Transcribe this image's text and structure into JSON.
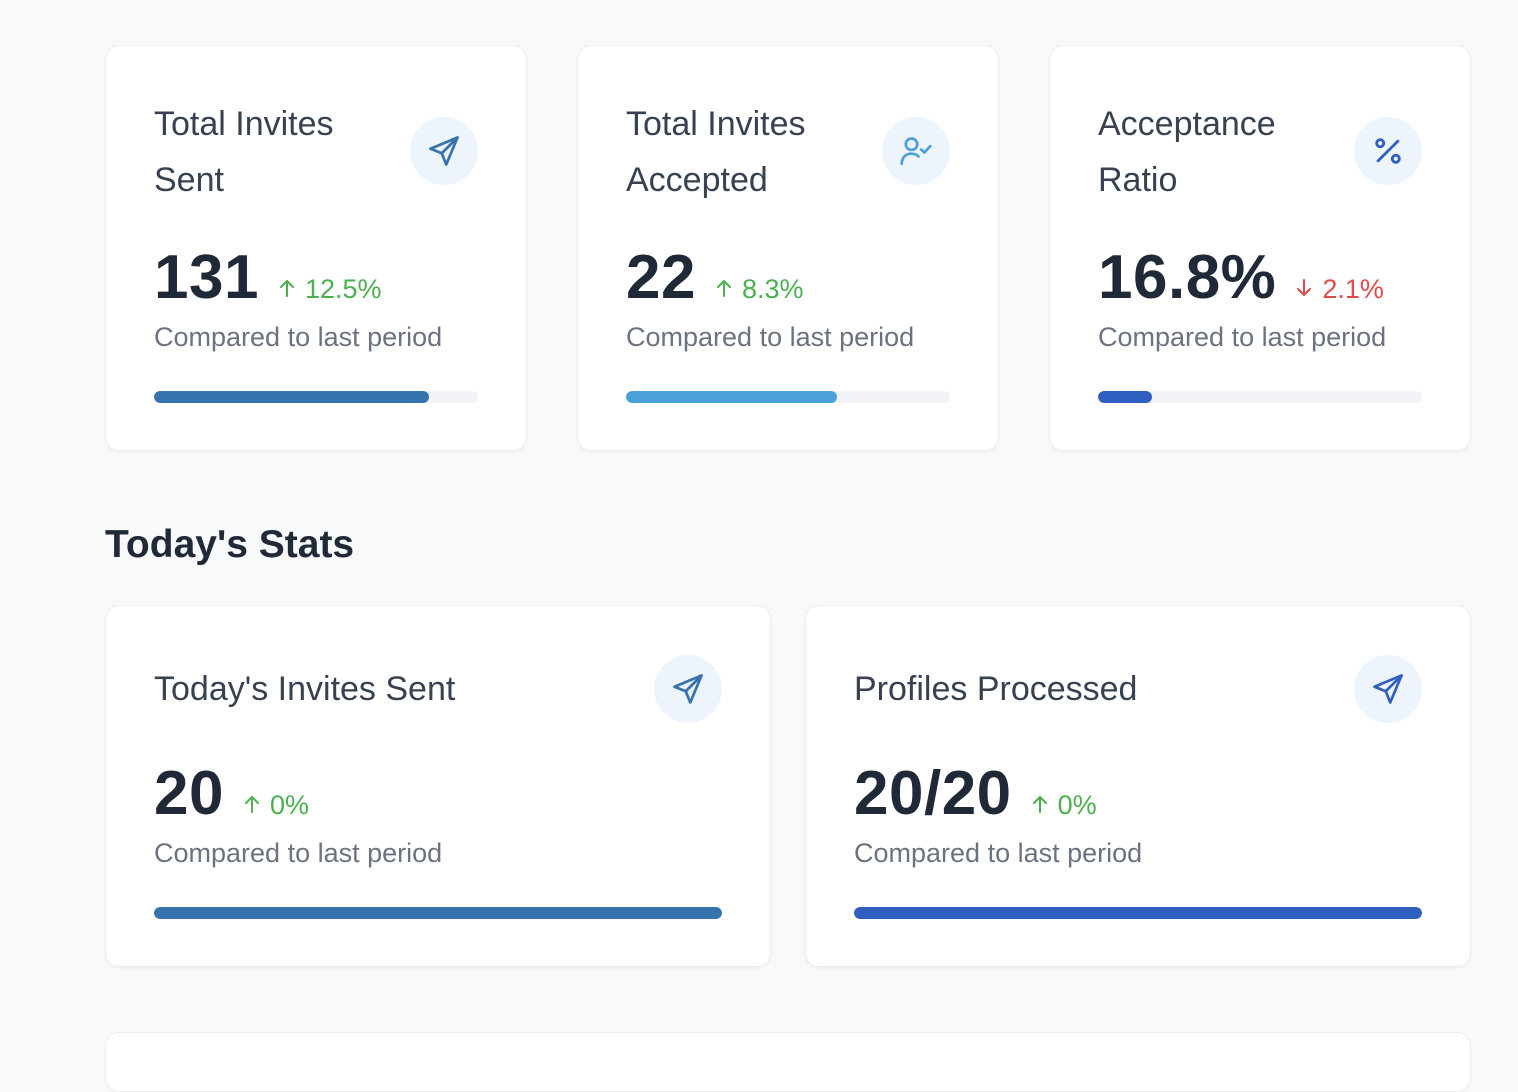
{
  "cards": [
    {
      "title": "Total Invites Sent",
      "icon": "send-icon",
      "value": "131",
      "change": "12.5%",
      "direction": "up",
      "subtext": "Compared to last period",
      "progress": 0.85,
      "bar_color": "#3572ae"
    },
    {
      "title": "Total Invites Accepted",
      "icon": "user-check-icon",
      "value": "22",
      "change": "8.3%",
      "direction": "up",
      "subtext": "Compared to last period",
      "progress": 0.65,
      "bar_color": "#4aa0d8"
    },
    {
      "title": "Acceptance Ratio",
      "icon": "percent-icon",
      "value": "16.8%",
      "change": "2.1%",
      "direction": "down",
      "subtext": "Compared to last period",
      "progress": 0.168,
      "bar_color": "#2f5fbf"
    }
  ],
  "today": {
    "section_title": "Today's Stats",
    "cards": [
      {
        "title": "Today's Invites Sent",
        "icon": "send-icon",
        "value": "20",
        "change": "0%",
        "direction": "up",
        "subtext": "Compared to last period",
        "progress": 1.0,
        "bar_color": "#3572ae"
      },
      {
        "title": "Profiles Processed",
        "icon": "send-icon",
        "value": "20/20",
        "change": "0%",
        "direction": "up",
        "subtext": "Compared to last period",
        "progress": 1.0,
        "bar_color": "#2f5fbf"
      }
    ]
  },
  "colors": {
    "up": "#4caf50",
    "down": "#e04b4b",
    "icon_blue": "#3572ae",
    "icon_light_blue": "#4aa0d8"
  }
}
